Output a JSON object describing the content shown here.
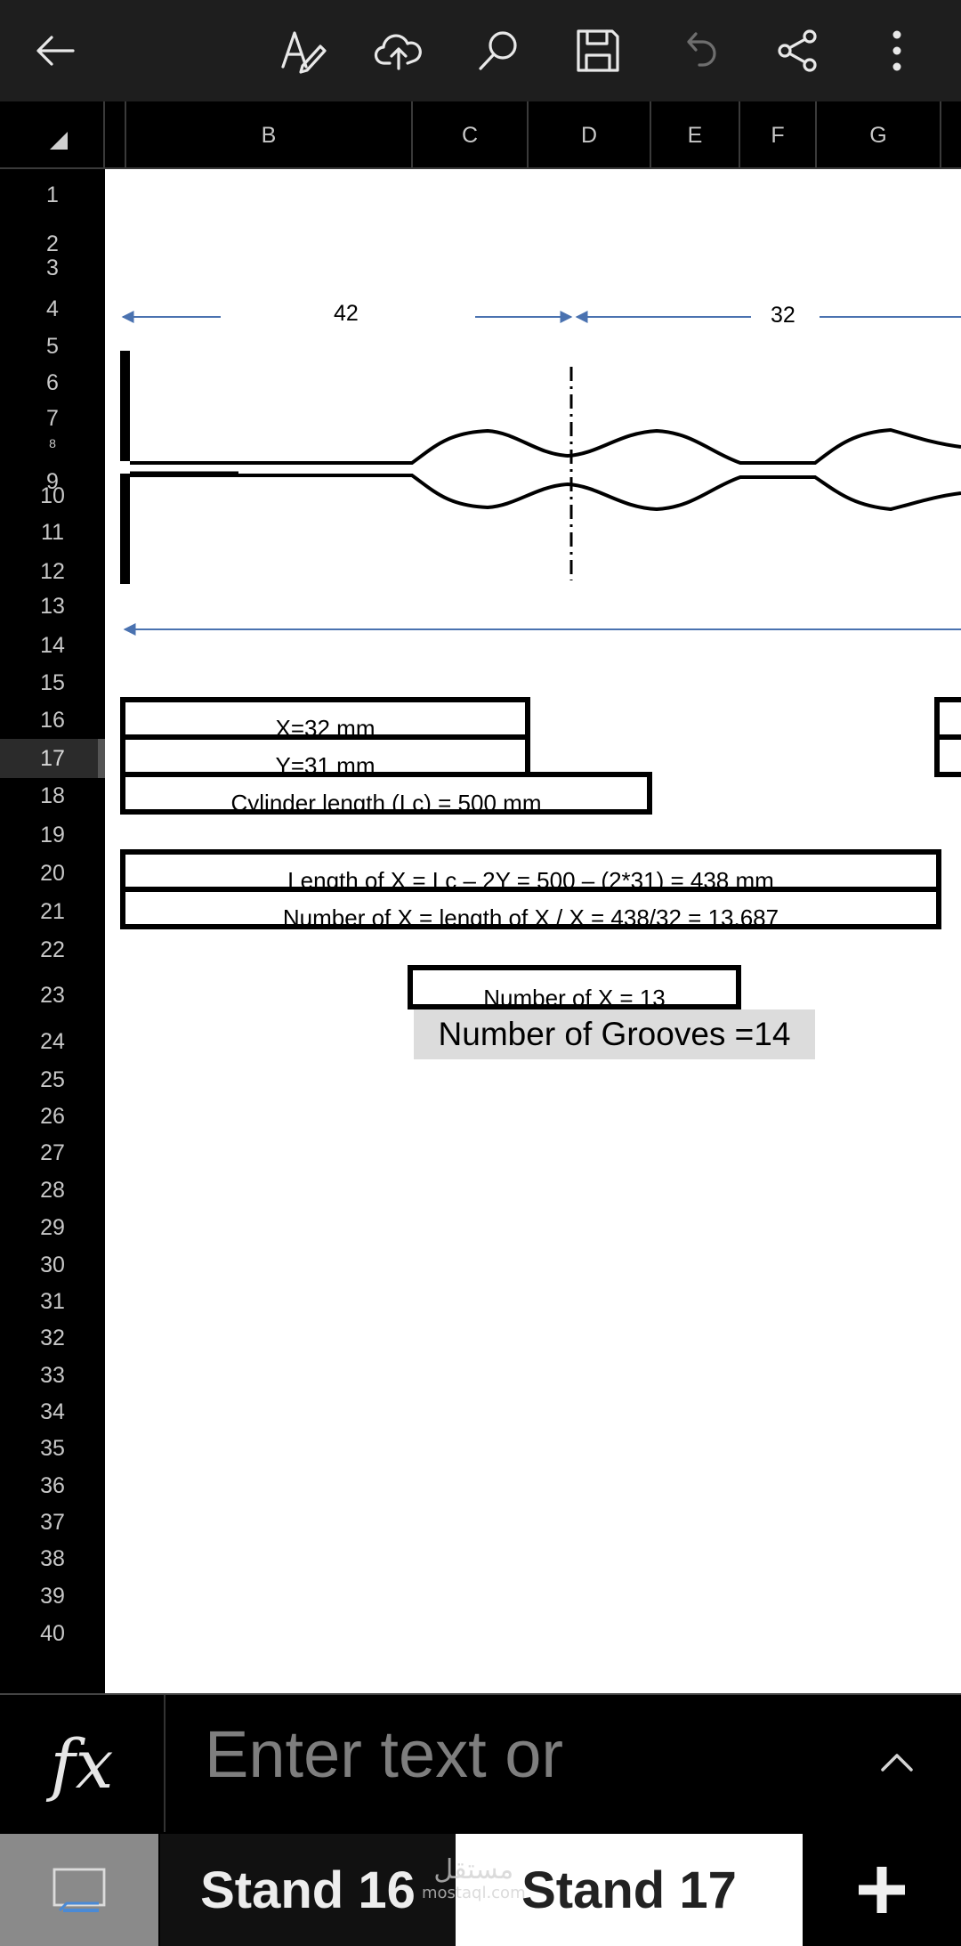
{
  "toolbar": {
    "icons": [
      "back-arrow-icon",
      "text-format-icon",
      "cloud-upload-icon",
      "search-icon",
      "save-icon",
      "undo-icon",
      "share-icon",
      "more-options-icon"
    ]
  },
  "columns": [
    "B",
    "C",
    "D",
    "E",
    "F",
    "G"
  ],
  "rows": [
    "1",
    "2",
    "3",
    "4",
    "5",
    "6",
    "7",
    "8",
    "9",
    "10",
    "11",
    "12",
    "13",
    "14",
    "15",
    "16",
    "17",
    "18",
    "19",
    "20",
    "21",
    "22",
    "23",
    "24",
    "25",
    "26",
    "27",
    "28",
    "29",
    "30",
    "31",
    "32",
    "33",
    "34",
    "35",
    "36",
    "37",
    "38",
    "39",
    "40"
  ],
  "active_row": "17",
  "drawing": {
    "dim_left": "42",
    "dim_right": "32"
  },
  "cells": {
    "x_value": "X=32 mm",
    "y_value": "Y=31 mm",
    "cylinder_length": "Cylinder length (Lc) = 500 mm",
    "length_of_x": "Length of X = Lc – 2Y = 500 – (2*31) = 438 mm",
    "number_of_x_calc": "Number of X = length of X / X = 438/32 = 13.687",
    "number_of_x": "Number of X = 13",
    "number_of_grooves": "Number of Grooves =14"
  },
  "formula_bar": {
    "fx_label": "fx",
    "placeholder": "Enter text or"
  },
  "tabs": {
    "sheet_1": "Stand 16",
    "sheet_2": "Stand 17",
    "active": "Stand 17"
  },
  "watermark": {
    "arabic": "مستقل",
    "latin": "mostaql.com"
  },
  "colors": {
    "arrow_blue": "#4a72b0",
    "grooves_fill": "#dcdcdc"
  }
}
